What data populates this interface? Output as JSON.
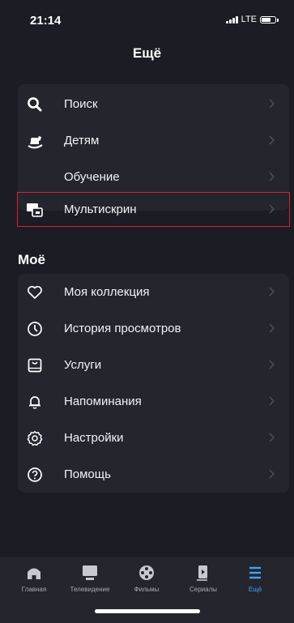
{
  "status": {
    "time": "21:14",
    "network": "LTE",
    "battery_level": 0.7
  },
  "page": {
    "title": "Ещё"
  },
  "menu_main": [
    {
      "label": "Поиск",
      "icon": "search-icon"
    },
    {
      "label": "Детям",
      "icon": "rocking-horse-icon"
    },
    {
      "label": "Обучение",
      "icon": ""
    },
    {
      "label": "Мультискрин",
      "icon": "multiscreen-icon",
      "highlighted": true
    }
  ],
  "section_mine": {
    "title": "Моё"
  },
  "menu_mine": [
    {
      "label": "Моя коллекция",
      "icon": "heart-icon"
    },
    {
      "label": "История просмотров",
      "icon": "clock-icon"
    },
    {
      "label": "Услуги",
      "icon": "bag-icon"
    },
    {
      "label": "Напоминания",
      "icon": "bell-icon"
    },
    {
      "label": "Настройки",
      "icon": "gear-icon"
    },
    {
      "label": "Помощь",
      "icon": "question-icon"
    }
  ],
  "tabbar": [
    {
      "label": "Главная",
      "icon": "home-icon"
    },
    {
      "label": "Телевидение",
      "icon": "tv-icon"
    },
    {
      "label": "Фильмы",
      "icon": "film-reel-icon"
    },
    {
      "label": "Сериалы",
      "icon": "series-icon"
    },
    {
      "label": "Ещё",
      "icon": "menu-icon",
      "active": true
    }
  ],
  "colors": {
    "background": "#1c1c24",
    "card": "#25252e",
    "accent": "#3ea3ff",
    "highlight": "#e01e2c"
  }
}
